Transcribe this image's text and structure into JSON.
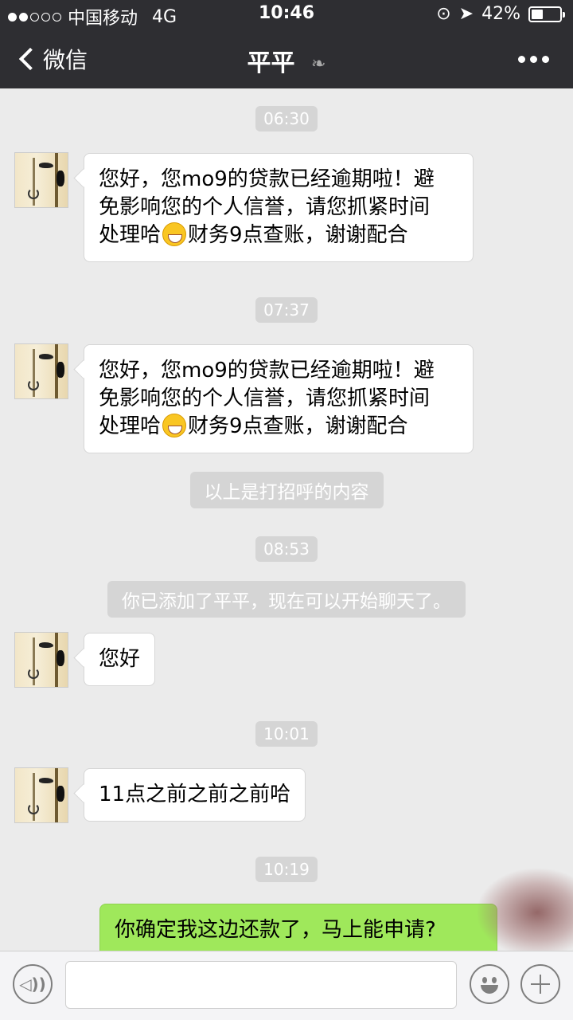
{
  "status_bar": {
    "carrier": "中国移动",
    "network": "4G",
    "time": "10:46",
    "battery": "42%",
    "battery_level": 0.42,
    "signal_bars_filled": 2,
    "signal_bars_total": 5
  },
  "nav": {
    "back_label": "微信",
    "title": "平平",
    "mute_icon": "ear-icon"
  },
  "messages": [
    {
      "type": "timestamp",
      "text": "06:30"
    },
    {
      "type": "incoming",
      "lines": [
        "您好，您mo9的贷款已经逾期啦！避",
        "免影响您的个人信誉，请您抓紧时间",
        "处理哈",
        "财务9点查账，谢谢配合"
      ],
      "emoji": "grinning-face"
    },
    {
      "type": "timestamp",
      "text": "07:37"
    },
    {
      "type": "incoming",
      "lines": [
        "您好，您mo9的贷款已经逾期啦！避",
        "免影响您的个人信誉，请您抓紧时间",
        "处理哈",
        "财务9点查账，谢谢配合"
      ],
      "emoji": "grinning-face"
    },
    {
      "type": "system",
      "text": "以上是打招呼的内容"
    },
    {
      "type": "timestamp",
      "text": "08:53"
    },
    {
      "type": "system",
      "text": "你已添加了平平，现在可以开始聊天了。"
    },
    {
      "type": "incoming",
      "text": "您好"
    },
    {
      "type": "timestamp",
      "text": "10:01"
    },
    {
      "type": "incoming",
      "text": "11点之前之前之前哈"
    },
    {
      "type": "timestamp",
      "text": "10:19"
    },
    {
      "type": "outgoing",
      "text": "你确定我这边还款了，马上能申请?"
    }
  ],
  "input_bar": {
    "voice_icon": "voice-icon",
    "text_value": "",
    "emoji_icon": "emoji-icon",
    "plus_icon": "plus-icon"
  },
  "colors": {
    "header_bg": "#2e2e32",
    "chat_bg": "#ebebeb",
    "outgoing_bubble": "#9fe85b",
    "incoming_bubble": "#ffffff",
    "timestamp_pill": "#d5d5d5"
  }
}
